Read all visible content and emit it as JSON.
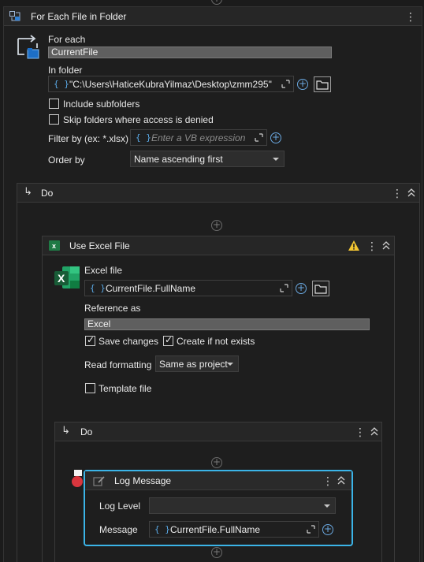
{
  "foreach": {
    "title": "For Each File in Folder",
    "for_each_label": "For each",
    "for_each_value": "CurrentFile",
    "in_folder_label": "In folder",
    "in_folder_value": "\"C:\\Users\\HaticeKubraYilmaz\\Desktop\\zmm295\"",
    "include_subfolders": "Include subfolders",
    "skip_folders": "Skip folders where access is denied",
    "filter_label": "Filter by (ex: *.xlsx)",
    "filter_placeholder": "Enter a VB expression",
    "order_label": "Order by",
    "order_value": "Name ascending first"
  },
  "do_outer": {
    "title": "Do"
  },
  "excel": {
    "title": "Use Excel File",
    "file_label": "Excel file",
    "file_value": "CurrentFile.FullName",
    "ref_label": "Reference as",
    "ref_value": "Excel",
    "save_changes": "Save changes",
    "create_if_not_exists": "Create if not exists",
    "read_formatting_label": "Read formatting",
    "read_formatting_value": "Same as project",
    "template_file": "Template file"
  },
  "do_inner": {
    "title": "Do"
  },
  "log": {
    "title": "Log Message",
    "level_label": "Log Level",
    "level_value": "",
    "message_label": "Message",
    "message_value": "CurrentFile.FullName"
  },
  "glyphs": {
    "brace": "{ }",
    "kebab": "⋮",
    "plus": "+",
    "do_arrow": "↳"
  },
  "colors": {
    "accent": "#3bb4e8",
    "link_blue": "#5aa9e6",
    "warning": "#f2c531",
    "excel_green": "#1f7a45",
    "error_red": "#d9363e"
  }
}
